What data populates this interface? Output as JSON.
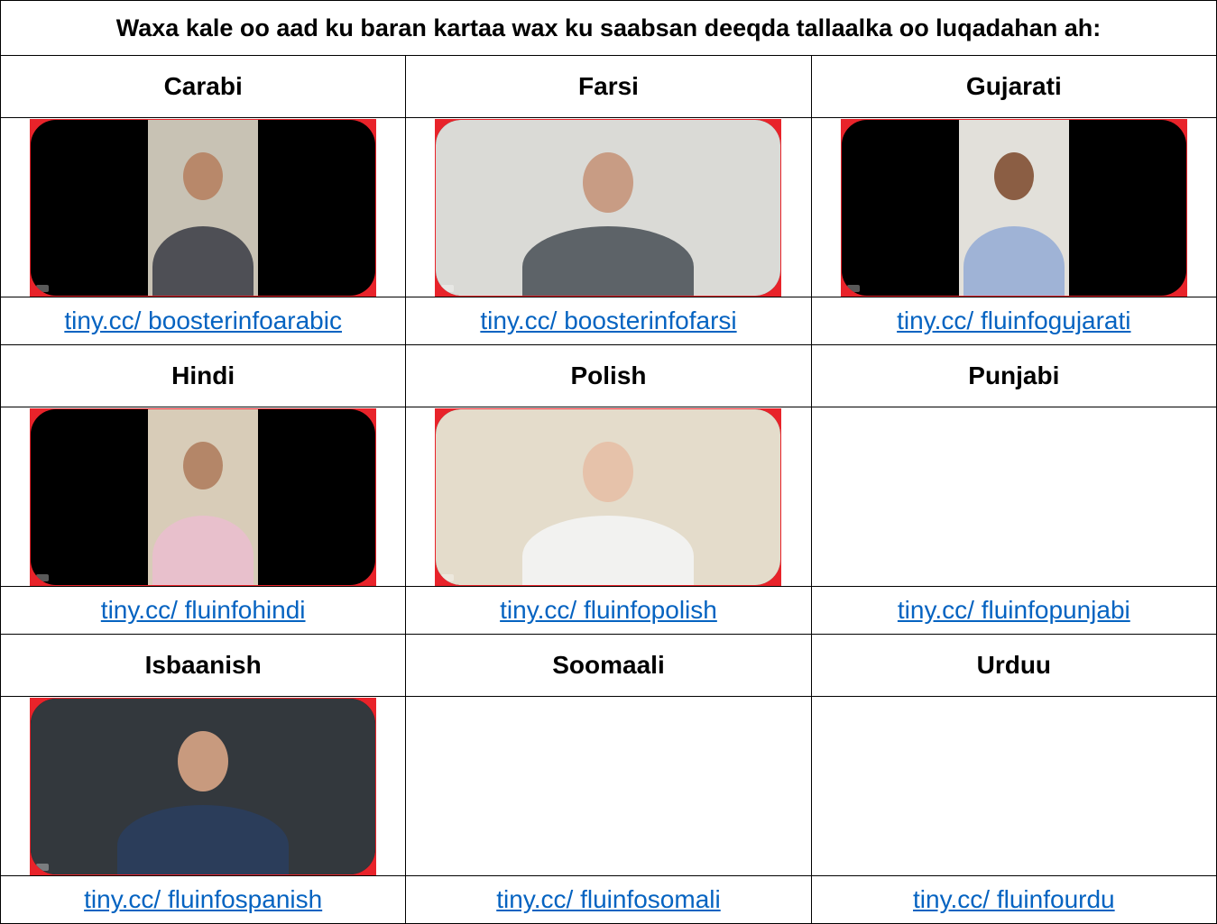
{
  "title": "Waxa kale oo aad ku baran kartaa wax ku saabsan deeqda tallaalka oo luqadahan ah:",
  "rows": [
    [
      {
        "language": "Carabi",
        "link": "tiny.cc/ boosterinfoarabic",
        "video": "narrow",
        "bg": "#c8c2b4",
        "head": "#b8886a",
        "body": "#4e4f55"
      },
      {
        "language": "Farsi",
        "link": "tiny.cc/ boosterinfofarsi",
        "video": "wide",
        "bg": "#dadad6",
        "head": "#c89c84",
        "body": "#5d6368"
      },
      {
        "language": "Gujarati",
        "link": "tiny.cc/ fluinfogujarati",
        "video": "narrow",
        "bg": "#e2e0da",
        "head": "#8b5e44",
        "body": "#9fb3d6"
      }
    ],
    [
      {
        "language": "Hindi",
        "link": "tiny.cc/ fluinfohindi",
        "video": "narrow",
        "bg": "#d8ccb8",
        "head": "#b48668",
        "body": "#e8c0cc"
      },
      {
        "language": "Polish",
        "link": "tiny.cc/ fluinfopolish",
        "video": "wide",
        "bg": "#e4dccb",
        "head": "#e6c2aa",
        "body": "#f2f2f0"
      },
      {
        "language": "Punjabi",
        "link": "tiny.cc/ fluinfopunjabi",
        "video": "none"
      }
    ],
    [
      {
        "language": "Isbaanish",
        "link": "tiny.cc/ fluinfospanish",
        "video": "wide",
        "bg": "#33383d",
        "head": "#c89a7e",
        "body": "#2b3d5a"
      },
      {
        "language": "Soomaali",
        "link": "tiny.cc/ fluinfosomali",
        "video": "none"
      },
      {
        "language": "Urduu",
        "link": "tiny.cc/ fluinfourdu",
        "video": "none"
      }
    ]
  ]
}
